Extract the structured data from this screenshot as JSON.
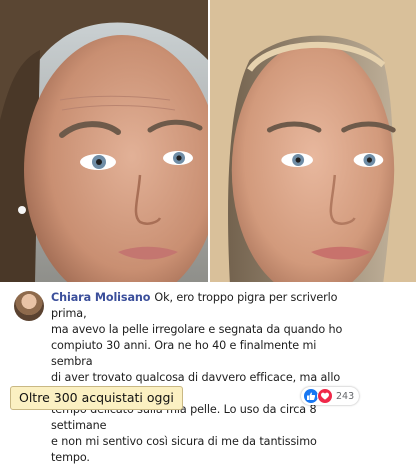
{
  "review": {
    "name": "Chiara Molisano",
    "line1": "Ok, ero troppo pigra per scriverlo prima,",
    "lines": [
      "ma avevo la pelle irregolare e segnata da quando ho",
      "compiuto 30 anni. Ora ne ho 40 e finalmente mi sembra",
      "di aver trovato qualcosa di davvero efficace, ma allo stesso",
      "tempo delicato sulla mia pelle. Lo uso da circa 8 settimane",
      "e non mi sentivo così sicura di me da tantissimo tempo."
    ]
  },
  "promo": {
    "label": "Oltre 300 acquistati oggi"
  },
  "reactions": {
    "count": "243",
    "icons": [
      "like-icon",
      "love-icon"
    ]
  },
  "colors": {
    "name": "#3b4f9b",
    "badge_bg": "#fbf0c2",
    "like": "#1877f2",
    "love": "#f02849"
  }
}
